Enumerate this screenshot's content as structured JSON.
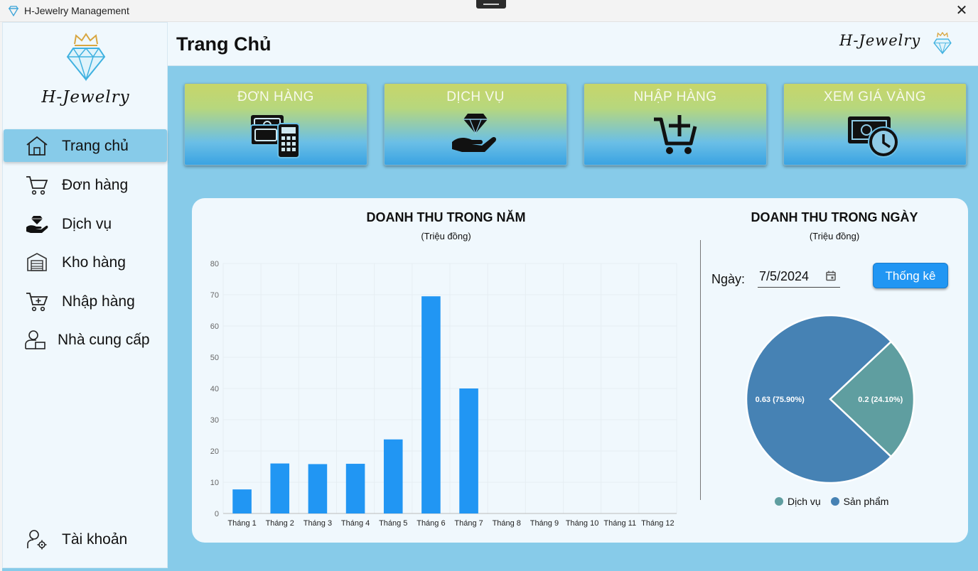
{
  "window": {
    "title": "H-Jewelry Management"
  },
  "sidebar": {
    "logo_text": "H-Jewelry",
    "items": [
      {
        "label": "Trang chủ",
        "icon": "home-icon",
        "active": true
      },
      {
        "label": "Đơn hàng",
        "icon": "cart-icon",
        "active": false
      },
      {
        "label": "Dịch vụ",
        "icon": "diamond-hand-icon",
        "active": false
      },
      {
        "label": "Kho hàng",
        "icon": "warehouse-icon",
        "active": false
      },
      {
        "label": "Nhập hàng",
        "icon": "cart-plus-icon",
        "active": false
      },
      {
        "label": "Nhà cung cấp",
        "icon": "supplier-icon",
        "active": false
      }
    ],
    "account_label": "Tài khoản"
  },
  "header": {
    "title": "Trang Chủ",
    "brand": "H-Jewelry"
  },
  "tiles": [
    {
      "label": "ĐƠN HÀNG",
      "icon": "money-calculator-icon"
    },
    {
      "label": "DỊCH VỤ",
      "icon": "diamond-hand-icon"
    },
    {
      "label": "NHẬP HÀNG",
      "icon": "cart-plus-icon"
    },
    {
      "label": "XEM GIÁ VÀNG",
      "icon": "money-clock-icon"
    }
  ],
  "daily": {
    "title": "DOANH THU TRONG NGÀY",
    "subtitle": "(Triệu đồng)",
    "date_label": "Ngày:",
    "date_value": "7/5/2024",
    "button_label": "Thống kê"
  },
  "colors": {
    "accent": "#2196f3",
    "bar": "#2196f3",
    "pie_service": "#5f9ea0",
    "pie_product": "#4682b4",
    "tile_top": "#c7d66a",
    "tile_bottom": "#3aa3e2"
  },
  "chart_data": [
    {
      "type": "bar",
      "title": "DOANH THU TRONG NĂM",
      "subtitle": "(Triệu đồng)",
      "categories": [
        "Tháng 1",
        "Tháng 2",
        "Tháng 3",
        "Tháng 4",
        "Tháng 5",
        "Tháng 6",
        "Tháng 7",
        "Tháng 8",
        "Tháng 9",
        "Tháng 10",
        "Tháng 11",
        "Tháng 12"
      ],
      "values": [
        7.7,
        16,
        15.8,
        15.9,
        23.7,
        69.5,
        40,
        0,
        0,
        0,
        0,
        0
      ],
      "ylim": [
        0,
        80
      ],
      "yticks": [
        0,
        10,
        20,
        30,
        40,
        50,
        60,
        70,
        80
      ],
      "grid": true
    },
    {
      "type": "pie",
      "slices": [
        {
          "name": "Dịch vụ",
          "value": 0.2,
          "label": "0.2 (24.10%)",
          "percent": 24.1,
          "color": "#5f9ea0"
        },
        {
          "name": "Sản phẩm",
          "value": 0.63,
          "label": "0.63 (75.90%)",
          "percent": 75.9,
          "color": "#4682b4"
        }
      ],
      "legend": "bottom"
    }
  ]
}
